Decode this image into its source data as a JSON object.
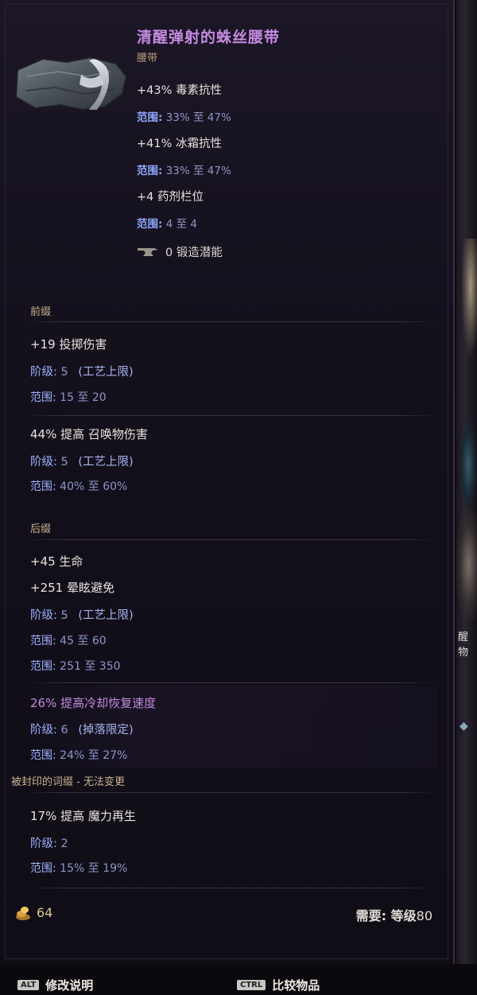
{
  "item": {
    "name": "清醒弹射的蛛丝腰带",
    "type": "腰带",
    "icon": "belt-icon"
  },
  "implicits": [
    {
      "stat": "+43% 毒素抗性",
      "range_label": "范围:",
      "range_value": "33% 至 47%"
    },
    {
      "stat": "+41% 冰霜抗性",
      "range_label": "范围:",
      "range_value": "33% 至 47%"
    },
    {
      "stat": "+4 药剂栏位",
      "range_label": "范围:",
      "range_value": "4 至 4"
    }
  ],
  "forge": {
    "value": "0 锻造潜能",
    "icon": "anvil-icon"
  },
  "prefix": {
    "title": "前缀",
    "affixes": [
      {
        "line": "+19 投掷伤害",
        "tier_label": "阶级:",
        "tier_value": "5",
        "tier_note": "(工艺上限)",
        "range_label": "范围:",
        "range_value": "15 至 20"
      },
      {
        "line": "44% 提高 召唤物伤害",
        "tier_label": "阶级:",
        "tier_value": "5",
        "tier_note": "(工艺上限)",
        "range_label": "范围:",
        "range_value": "40% 至 60%"
      }
    ]
  },
  "suffix": {
    "title": "后缀",
    "affix1": {
      "line1": "+45 生命",
      "line2": "+251 晕眩避免",
      "tier_label": "阶级:",
      "tier_value": "5",
      "tier_note": "(工艺上限)",
      "range1_label": "范围:",
      "range1_value": "45 至 60",
      "range2_label": "范围:",
      "range2_value": "251 至 350"
    },
    "affix2": {
      "line": "26% 提高冷却恢复速度",
      "tier_label": "阶级:",
      "tier_value": "6",
      "tier_note": "(掉落限定)",
      "range_label": "范围:",
      "range_value": "24% 至 27%"
    }
  },
  "sealed": {
    "title": "被封印的词缀 - 无法变更",
    "line": "17% 提高 魔力再生",
    "tier_label": "阶级:",
    "tier_value": "2",
    "range_label": "范围:",
    "range_value": "15% 至 19%"
  },
  "footer": {
    "price": "64",
    "price_icon": "gold-pile-icon",
    "requirement_label": "需要: 等级",
    "requirement_level": "80"
  },
  "hotkeys": [
    {
      "key": "ALT",
      "label": "修改说明"
    },
    {
      "key": "CTRL",
      "label": "比较物品"
    }
  ],
  "side": {
    "label": "醒物"
  },
  "colors": {
    "item_name": "#c48ae0",
    "range_label": "#8fa8ff",
    "section_title": "#c8b490"
  }
}
